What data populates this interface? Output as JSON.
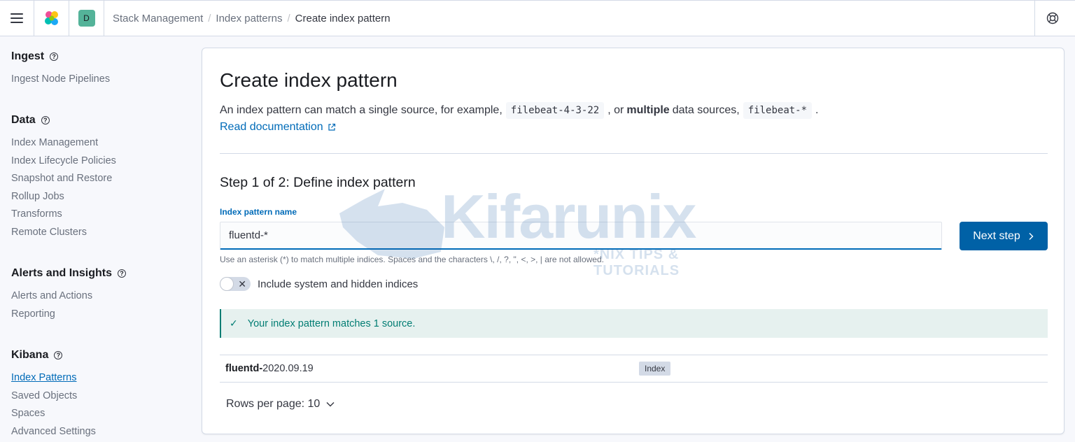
{
  "header": {
    "breadcrumbs": [
      "Stack Management",
      "Index patterns",
      "Create index pattern"
    ],
    "space_initial": "D"
  },
  "sidebar": {
    "sections": [
      {
        "title": "Ingest",
        "items": [
          "Ingest Node Pipelines"
        ]
      },
      {
        "title": "Data",
        "items": [
          "Index Management",
          "Index Lifecycle Policies",
          "Snapshot and Restore",
          "Rollup Jobs",
          "Transforms",
          "Remote Clusters"
        ]
      },
      {
        "title": "Alerts and Insights",
        "items": [
          "Alerts and Actions",
          "Reporting"
        ]
      },
      {
        "title": "Kibana",
        "items": [
          "Index Patterns",
          "Saved Objects",
          "Spaces",
          "Advanced Settings"
        ]
      }
    ],
    "active_item": "Index Patterns"
  },
  "main": {
    "title": "Create index pattern",
    "desc_prefix": "An index pattern can match a single source, for example,",
    "example_single": "filebeat-4-3-22",
    "desc_mid": ", or",
    "desc_bold": "multiple",
    "desc_mid2": "data sources,",
    "example_multi": "filebeat-*",
    "desc_end": ".",
    "doc_link": "Read documentation",
    "step_title": "Step 1 of 2: Define index pattern",
    "field_label": "Index pattern name",
    "input_value": "fluentd-*",
    "help_text": "Use an asterisk (*) to match multiple indices. Spaces and the characters \\, /, ?, \", <, >, | are not allowed.",
    "next_button": "Next step",
    "toggle_label": "Include system and hidden indices",
    "callout_text": "Your index pattern matches 1 source.",
    "results": [
      {
        "name_bold": "fluentd-",
        "name_rest": "2020.09.19",
        "badge": "Index"
      }
    ],
    "rows_per_page": "Rows per page: 10"
  },
  "watermark": {
    "text": "Kifarunix",
    "sub": "*NIX TIPS & TUTORIALS"
  },
  "colors": {
    "primary": "#006bb8",
    "button": "#0061a6",
    "success": "#017d73",
    "success_bg": "#e6f1ef"
  }
}
